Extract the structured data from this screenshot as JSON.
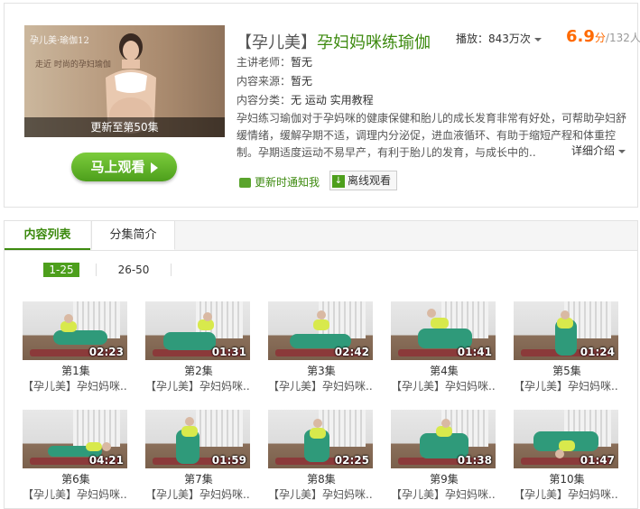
{
  "header": {
    "title_bracket": "【孕儿美】",
    "title_name": "孕妇妈咪练瑜伽",
    "plays_label": "播放：",
    "plays_value": "843万次",
    "score_big": "6.9",
    "score_unit": "分",
    "score_count": "/132人"
  },
  "cover": {
    "overlay_text": "孕儿美·瑜伽12",
    "sub_text": "走近 时尚的孕妇瑜伽",
    "banner": "更新至第50集"
  },
  "watch_button": "马上观看",
  "meta": {
    "teacher_label": "主讲老师：",
    "teacher_value": "暂无",
    "source_label": "内容来源：",
    "source_value": "暂无",
    "category_label": "内容分类：",
    "category_value": "无 运动 实用教程"
  },
  "description": "孕妇练习瑜伽对于孕妈咪的健康保健和胎儿的成长发育非常有好处，可帮助孕妇舒缓情绪，缓解孕期不适，调理内分泌促，进血液循环、有助于缩短产程和体重控制。孕期适度运动不易早产，有利于胎儿的发育，与成长中的..",
  "more_link": "详细介绍",
  "notify_label": "更新时通知我",
  "offline_label": "离线观看",
  "tabs": [
    "内容列表",
    "分集简介"
  ],
  "pages": [
    "1-25",
    "26-50"
  ],
  "episodes": [
    {
      "no": "第1集",
      "name": "【孕儿美】孕妇妈咪..",
      "duration": "02:23"
    },
    {
      "no": "第2集",
      "name": "【孕儿美】孕妇妈咪..",
      "duration": "01:31"
    },
    {
      "no": "第3集",
      "name": "【孕儿美】孕妇妈咪..",
      "duration": "02:42"
    },
    {
      "no": "第4集",
      "name": "【孕儿美】孕妇妈咪..",
      "duration": "01:41"
    },
    {
      "no": "第5集",
      "name": "【孕儿美】孕妇妈咪..",
      "duration": "01:24"
    },
    {
      "no": "第6集",
      "name": "【孕儿美】孕妇妈咪..",
      "duration": "04:21"
    },
    {
      "no": "第7集",
      "name": "【孕儿美】孕妇妈咪..",
      "duration": "01:59"
    },
    {
      "no": "第8集",
      "name": "【孕儿美】孕妇妈咪..",
      "duration": "02:25"
    },
    {
      "no": "第9集",
      "name": "【孕儿美】孕妇妈咪..",
      "duration": "01:38"
    },
    {
      "no": "第10集",
      "name": "【孕儿美】孕妇妈咪..",
      "duration": "01:47"
    }
  ],
  "icons": {
    "play": "play-icon",
    "speaker": "speaker-icon",
    "download": "download-icon",
    "caret": "chevron-down-icon"
  },
  "colors": {
    "accent_green": "#3d8a0f",
    "button_green": "#4d9f1c",
    "score_orange": "#ff6a00"
  }
}
